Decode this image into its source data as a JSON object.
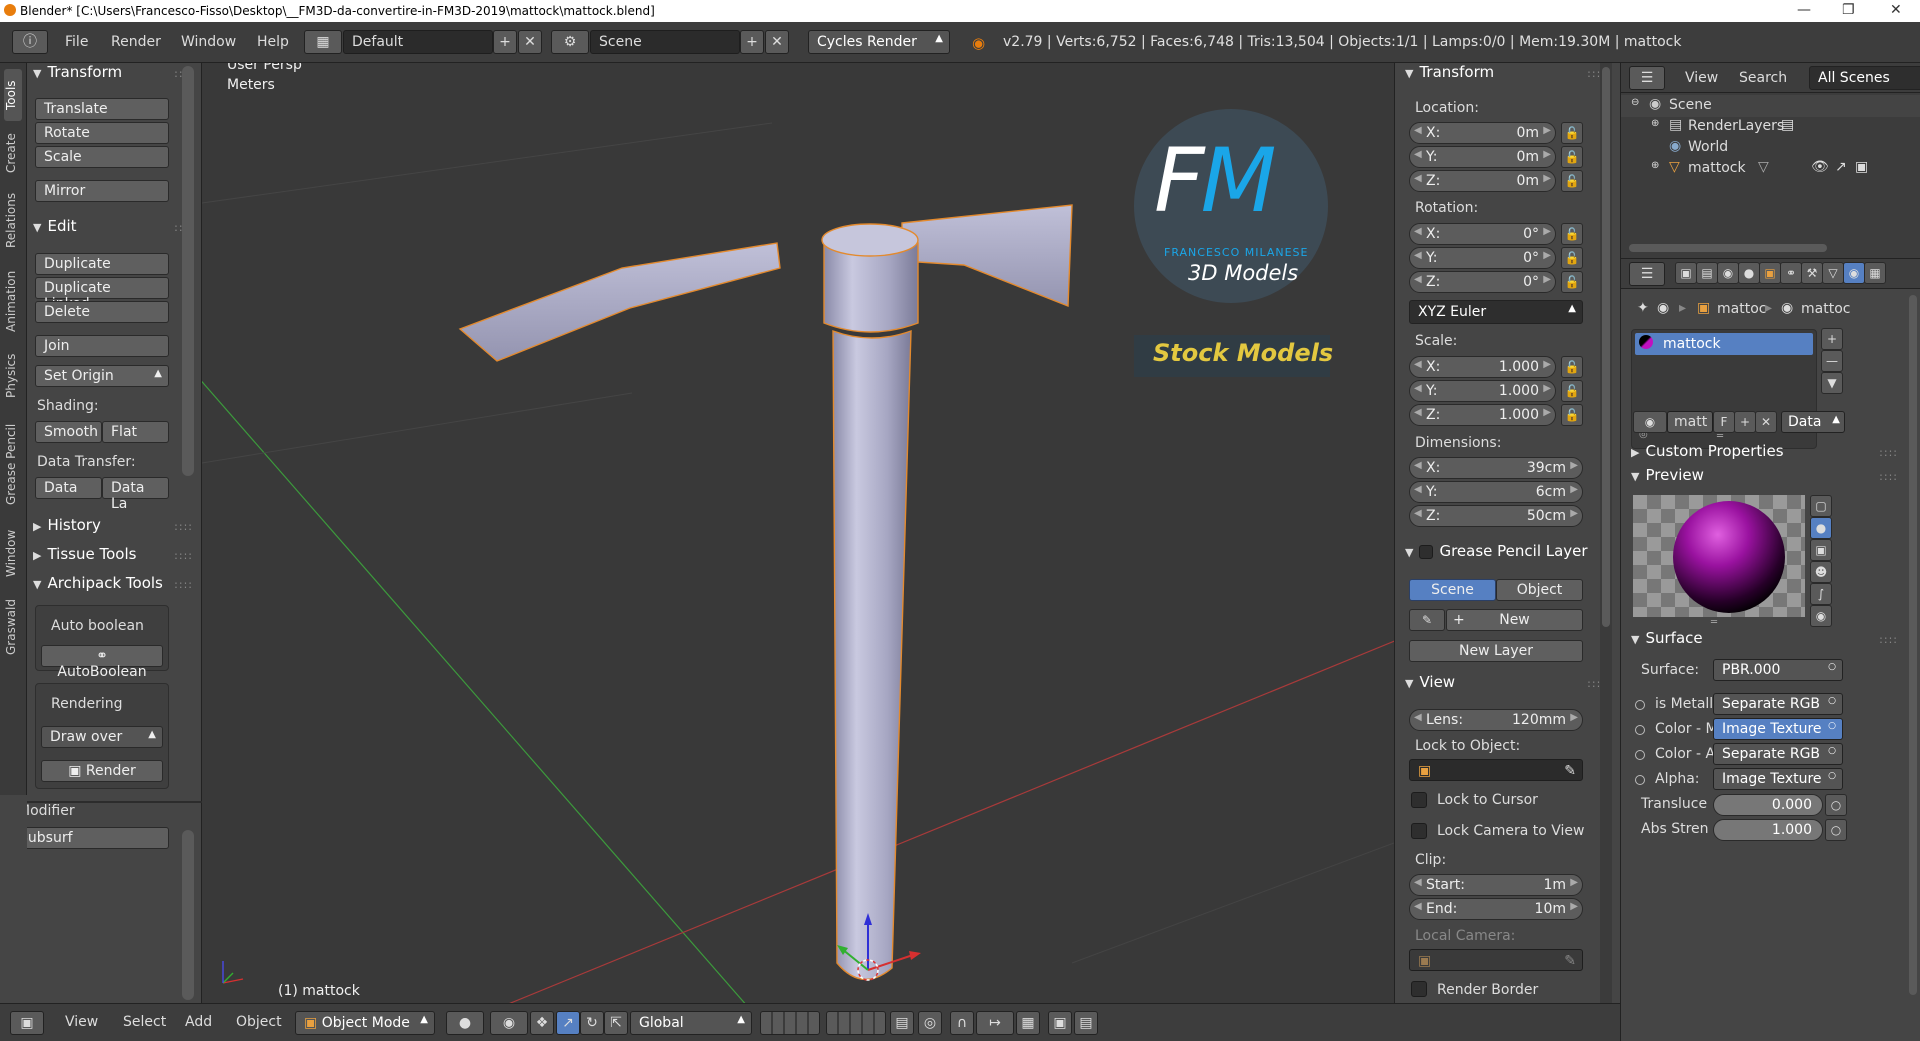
{
  "titlebar": {
    "title": "Blender* [C:\\Users\\Francesco-Fisso\\Desktop\\__FM3D-da-convertire-in-FM3D-2019\\mattock\\mattock.blend]"
  },
  "menu": {
    "file": "File",
    "render": "Render",
    "window": "Window",
    "help": "Help"
  },
  "header": {
    "layout": "Default",
    "scene": "Scene",
    "engine": "Cycles Render",
    "stats": "v2.79 | Verts:6,752 | Faces:6,748 | Tris:13,504 | Objects:1/1 | Lamps:0/0 | Mem:19.30M | mattock"
  },
  "tabs": [
    "Tools",
    "Create",
    "Relations",
    "Animation",
    "Physics",
    "Grease Pencil",
    "Window",
    "Graswald"
  ],
  "toolshelf": {
    "transform": {
      "title": "Transform",
      "translate": "Translate",
      "rotate": "Rotate",
      "scale": "Scale",
      "mirror": "Mirror"
    },
    "edit": {
      "title": "Edit",
      "duplicate": "Duplicate",
      "duplicate_linked": "Duplicate Linked",
      "delete": "Delete",
      "join": "Join",
      "set_origin": "Set Origin",
      "shading_label": "Shading:",
      "smooth": "Smooth",
      "flat": "Flat",
      "data_transfer_label": "Data Transfer:",
      "data": "Data",
      "data_la": "Data La"
    },
    "history": "History",
    "tissue_tools": "Tissue Tools",
    "archipack": {
      "title": "Archipack Tools",
      "auto_boolean_label": "Auto boolean",
      "auto_boolean_button": "AutoBoolean",
      "rendering_label": "Rendering",
      "draw_over": "Draw over",
      "render": "Render"
    },
    "modifier": {
      "label": "Modifier",
      "value": "Subsurf"
    }
  },
  "viewport": {
    "view_name": "User Persp",
    "units": "Meters",
    "object_label": "(1) mattock",
    "watermark": {
      "letters1": "F",
      "letters2": "M",
      "name": "FRANCESCO MILANESE",
      "tagline": "3D Models",
      "stock": "Stock Models"
    }
  },
  "props": {
    "transform_title": "Transform",
    "location_label": "Location:",
    "location": {
      "x": "0m",
      "y": "0m",
      "z": "0m"
    },
    "rotation_label": "Rotation:",
    "rotation": {
      "x": "0°",
      "y": "0°",
      "z": "0°"
    },
    "rotation_mode": "XYZ Euler",
    "scale_label": "Scale:",
    "scale": {
      "x": "1.000",
      "y": "1.000",
      "z": "1.000"
    },
    "dimensions_label": "Dimensions:",
    "dimensions": {
      "x": "39cm",
      "y": "6cm",
      "z": "50cm"
    },
    "axis": {
      "x": "X:",
      "y": "Y:",
      "z": "Z:"
    },
    "grease_title": "Grease Pencil Layer",
    "scene_btn": "Scene",
    "object_btn": "Object",
    "new_btn": "New",
    "new_layer_btn": "New Layer",
    "view_title": "View",
    "lens_label": "Lens:",
    "lens_value": "120mm",
    "lock_object_label": "Lock to Object:",
    "lock_cursor": "Lock to Cursor",
    "lock_camera": "Lock Camera to View",
    "clip_label": "Clip:",
    "clip_start_label": "Start:",
    "clip_start": "1m",
    "clip_end_label": "End:",
    "clip_end": "10m",
    "local_camera_label": "Local Camera:",
    "render_border": "Render Border"
  },
  "outliner": {
    "view": "View",
    "search": "Search",
    "all_scenes": "All Scenes",
    "items": [
      "Scene",
      "RenderLayers",
      "World",
      "mattock"
    ]
  },
  "propeditor": {
    "breadcrumb1": "mattoc",
    "breadcrumb2": "mattoc",
    "material_slot": "mattock",
    "mat_name": "matt",
    "mat_f": "F",
    "data_link": "Data",
    "custom_props": "Custom Properties",
    "preview_title": "Preview",
    "surface_title": "Surface",
    "surface_label": "Surface:",
    "surface_value": "PBR.000",
    "inputs": [
      {
        "label": "is Metallic",
        "value": "Separate RGB"
      },
      {
        "label": "Color - Ma",
        "value": "Image Texture"
      },
      {
        "label": "Color - Ab",
        "value": "Separate RGB"
      },
      {
        "label": "Alpha:",
        "value": "Image Texture"
      }
    ],
    "transluce_label": "Transluce",
    "transluce_value": "0.000",
    "abs_label": "Abs Stren",
    "abs_value": "1.000"
  },
  "bottombar": {
    "view": "View",
    "select": "Select",
    "add": "Add",
    "object": "Object",
    "mode": "Object Mode",
    "orientation": "Global"
  },
  "colors": {
    "accent_blue": "#5680c2",
    "selection_orange": "#e38a2e",
    "stock_yellow": "#e3c840"
  }
}
